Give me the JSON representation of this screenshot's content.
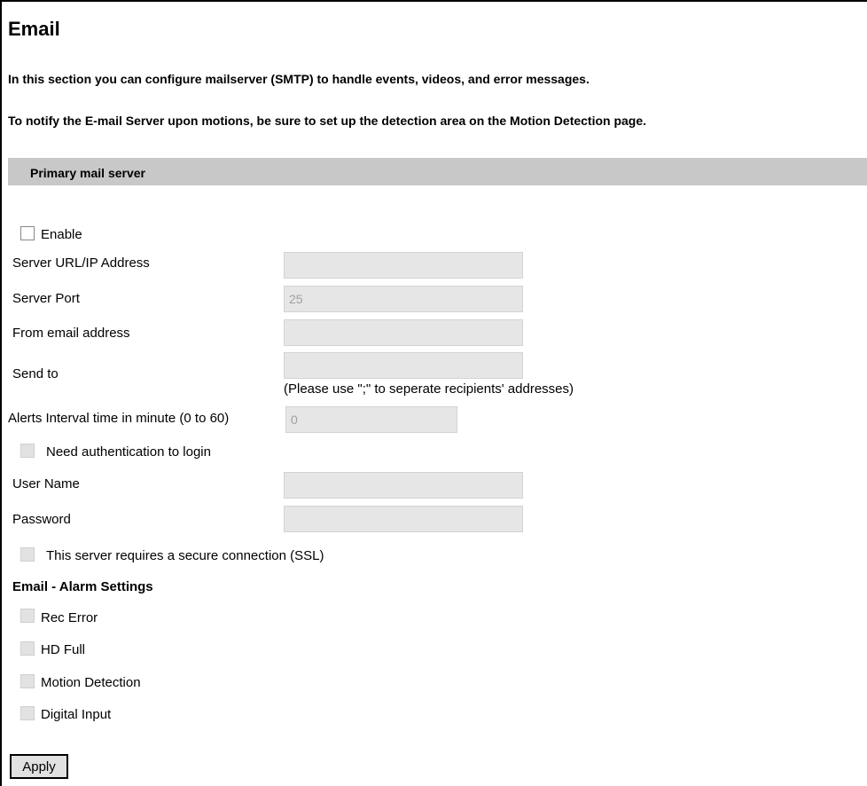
{
  "page": {
    "title": "Email",
    "intro": "In this section you can configure mailserver (SMTP) to handle events, videos, and error messages.",
    "notice": "To notify the E-mail Server upon motions, be sure to set up the detection area on the Motion Detection page."
  },
  "primary_server": {
    "header": "Primary mail server",
    "enable": {
      "label": "Enable",
      "checked": false
    },
    "server_url": {
      "label": "Server URL/IP Address",
      "value": ""
    },
    "server_port": {
      "label": "Server Port",
      "value": "25"
    },
    "from_email": {
      "label": "From email address",
      "value": ""
    },
    "send_to": {
      "label": "Send to",
      "value": "",
      "hint": "(Please use \";\" to seperate recipients' addresses)"
    },
    "alerts_interval": {
      "label": "Alerts Interval time in minute (0 to 60)",
      "value": "0"
    },
    "need_auth": {
      "label": "Need authentication to login",
      "checked": false
    },
    "user_name": {
      "label": "User Name",
      "value": ""
    },
    "password": {
      "label": "Password",
      "value": ""
    },
    "ssl": {
      "label": "This server requires a secure connection (SSL)",
      "checked": false
    }
  },
  "alarm_settings": {
    "header": "Email - Alarm Settings",
    "items": [
      {
        "label": "Rec Error",
        "checked": false
      },
      {
        "label": "HD Full",
        "checked": false
      },
      {
        "label": "Motion Detection",
        "checked": false
      },
      {
        "label": "Digital Input",
        "checked": false
      }
    ]
  },
  "apply_label": "Apply"
}
